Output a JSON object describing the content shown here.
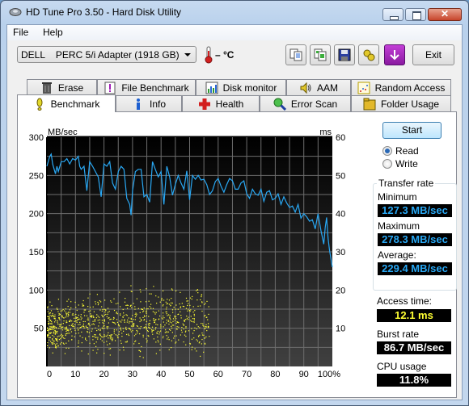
{
  "window": {
    "title": "HD Tune Pro 3.50 - Hard Disk Utility"
  },
  "menu": [
    {
      "label": "File"
    },
    {
      "label": "Help"
    }
  ],
  "toolbar": {
    "drive": "DELL    PERC 5/i Adapter (1918 GB)",
    "temperature": "– °C",
    "buttons": [
      {
        "icon": "copy-text-icon"
      },
      {
        "icon": "copy-screenshot-icon"
      },
      {
        "icon": "save-icon"
      },
      {
        "icon": "options-icon"
      },
      {
        "icon": "download-arrow-icon"
      }
    ],
    "exit_label": "Exit"
  },
  "tabs": {
    "row1": [
      {
        "label": "Erase",
        "icon": "trash-icon"
      },
      {
        "label": "File Benchmark",
        "icon": "file-benchmark-icon"
      },
      {
        "label": "Disk monitor",
        "icon": "disk-monitor-icon"
      },
      {
        "label": "AAM",
        "icon": "speaker-icon"
      },
      {
        "label": "Random Access",
        "icon": "random-access-icon"
      }
    ],
    "row2": [
      {
        "label": "Benchmark",
        "icon": "exclamation-icon",
        "active": true
      },
      {
        "label": "Info",
        "icon": "info-icon"
      },
      {
        "label": "Health",
        "icon": "health-cross-icon"
      },
      {
        "label": "Error Scan",
        "icon": "magnifier-icon"
      },
      {
        "label": "Folder Usage",
        "icon": "folder-icon"
      }
    ]
  },
  "side": {
    "start_label": "Start",
    "mode_options": [
      {
        "label": "Read",
        "selected": true
      },
      {
        "label": "Write",
        "selected": false
      }
    ],
    "transfer_rate_title": "Transfer rate",
    "minimum_label": "Minimum",
    "minimum_value": "127.3 MB/sec",
    "maximum_label": "Maximum",
    "maximum_value": "278.3 MB/sec",
    "average_label": "Average:",
    "average_value": "229.4 MB/sec",
    "access_time_label": "Access time:",
    "access_time_value": "12.1 ms",
    "burst_rate_label": "Burst rate",
    "burst_rate_value": "86.7 MB/sec",
    "cpu_usage_label": "CPU usage",
    "cpu_usage_value": "11.8%"
  },
  "colors": {
    "transfer_line": "#29a8f4",
    "access_points": "#ffff33",
    "plot_bg_top": "#000000",
    "plot_bg_bottom": "#404040",
    "grid": "#6e6e6e"
  },
  "chart_data": {
    "type": "line",
    "title": "",
    "xlabel": "",
    "ylabel_left": "MB/sec",
    "ylabel_right": "ms",
    "xlim": [
      0,
      100
    ],
    "ylim_left": [
      0,
      300
    ],
    "ylim_right": [
      0,
      60
    ],
    "x_ticks": [
      "0",
      "10",
      "20",
      "30",
      "40",
      "50",
      "60",
      "70",
      "80",
      "90",
      "100%"
    ],
    "y_ticks_left": [
      "50",
      "100",
      "150",
      "200",
      "250",
      "300"
    ],
    "y_ticks_right": [
      "10",
      "20",
      "30",
      "40",
      "50",
      "60"
    ],
    "grid": true,
    "series": [
      {
        "name": "Transfer rate",
        "axis": "left",
        "type": "line",
        "x": [
          0,
          1,
          1.5,
          2,
          3,
          3.5,
          4,
          5,
          6,
          7,
          8,
          9,
          10,
          11,
          11.5,
          12,
          13,
          14,
          15,
          16,
          17,
          18,
          19,
          20,
          21,
          22,
          23,
          24,
          25,
          26,
          27,
          28,
          29,
          29.5,
          30,
          31,
          32,
          33,
          34,
          35,
          36,
          37,
          38,
          39,
          40,
          41,
          42,
          43,
          44,
          45,
          46,
          47,
          48,
          49,
          50,
          51,
          52,
          53,
          54,
          55,
          56,
          57,
          58,
          59,
          60,
          61,
          62,
          63,
          64,
          65,
          66,
          67,
          68,
          69,
          70,
          71,
          72,
          73,
          74,
          75,
          76,
          77,
          78,
          79,
          80,
          81,
          82,
          83,
          84,
          85,
          86,
          87,
          88,
          89,
          90,
          91,
          92,
          93,
          94,
          95,
          96,
          97,
          97.5,
          98,
          98.5,
          99,
          100
        ],
        "values": [
          262,
          275,
          278,
          265,
          252,
          262,
          255,
          268,
          268,
          272,
          265,
          272,
          270,
          275,
          262,
          258,
          262,
          230,
          268,
          262,
          255,
          248,
          222,
          265,
          262,
          268,
          240,
          232,
          255,
          262,
          258,
          220,
          212,
          198,
          230,
          255,
          258,
          258,
          222,
          225,
          215,
          268,
          258,
          248,
          255,
          212,
          262,
          248,
          224,
          238,
          250,
          240,
          232,
          256,
          218,
          250,
          245,
          250,
          244,
          245,
          238,
          225,
          230,
          242,
          246,
          236,
          228,
          238,
          246,
          243,
          232,
          232,
          240,
          243,
          226,
          220,
          232,
          226,
          224,
          232,
          216,
          228,
          230,
          218,
          220,
          226,
          212,
          222,
          214,
          208,
          210,
          202,
          212,
          194,
          200,
          196,
          190,
          192,
          180,
          200,
          178,
          160,
          182,
          195,
          168,
          152,
          130,
          160,
          155,
          150
        ]
      },
      {
        "name": "Access time",
        "axis": "right",
        "type": "scatter",
        "summary": "Dense yellow scatter of roughly 1000 access-time samples spanning 0–57% of the x-axis, mostly between 5 and 20 ms (centered near 12 ms), a few outliers up to ~22 ms"
      }
    ]
  }
}
